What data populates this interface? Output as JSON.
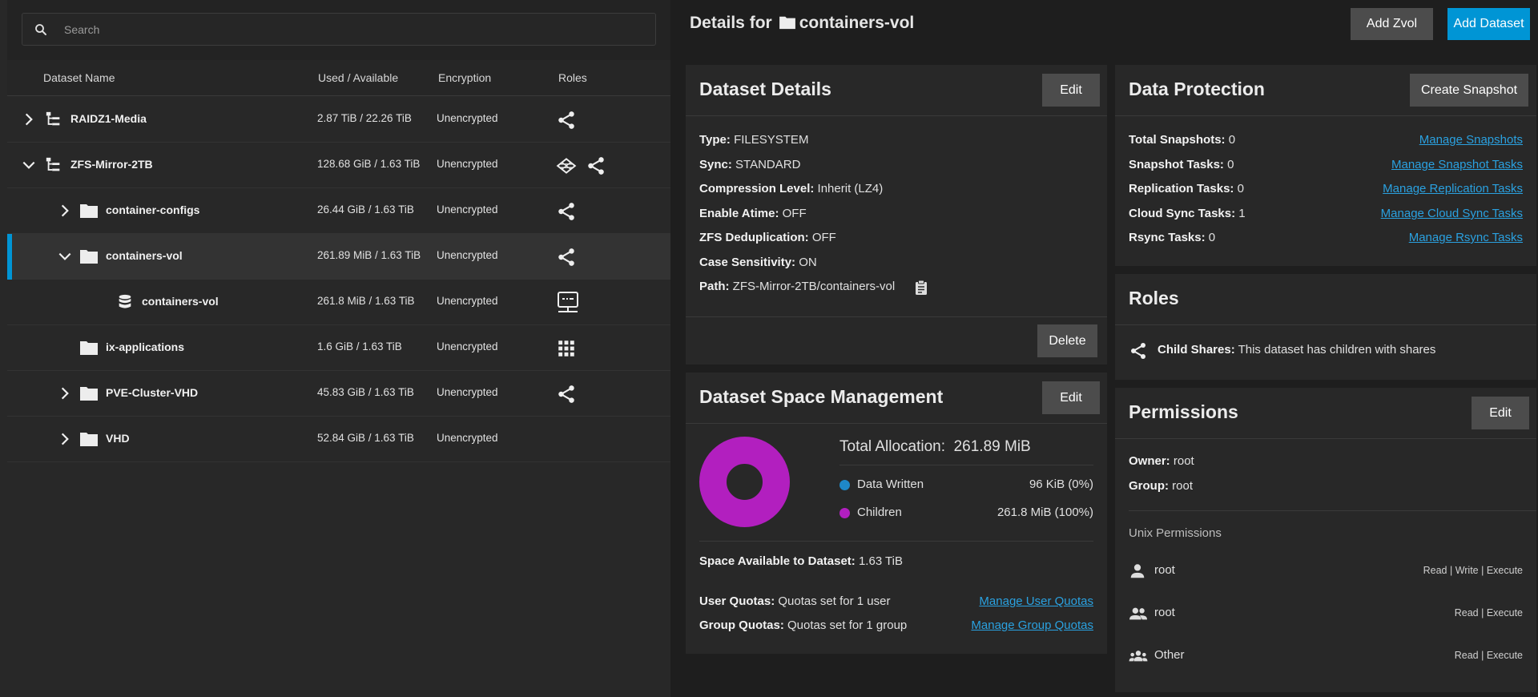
{
  "search": {
    "placeholder": "Search"
  },
  "table": {
    "headers": {
      "name": "Dataset Name",
      "used": "Used / Available",
      "encryption": "Encryption",
      "roles": "Roles"
    },
    "rows": [
      {
        "name": "RAIDZ1-Media",
        "used": "2.87 TiB / 22.26 TiB",
        "encryption": "Unencrypted"
      },
      {
        "name": "ZFS-Mirror-2TB",
        "used": "128.68 GiB / 1.63 TiB",
        "encryption": "Unencrypted"
      },
      {
        "name": "container-configs",
        "used": "26.44 GiB / 1.63 TiB",
        "encryption": "Unencrypted"
      },
      {
        "name": "containers-vol",
        "used": "261.89 MiB / 1.63 TiB",
        "encryption": "Unencrypted"
      },
      {
        "name": "containers-vol",
        "used": "261.8 MiB / 1.63 TiB",
        "encryption": "Unencrypted"
      },
      {
        "name": "ix-applications",
        "used": "1.6 GiB / 1.63 TiB",
        "encryption": "Unencrypted"
      },
      {
        "name": "PVE-Cluster-VHD",
        "used": "45.83 GiB / 1.63 TiB",
        "encryption": "Unencrypted"
      },
      {
        "name": "VHD",
        "used": "52.84 GiB / 1.63 TiB",
        "encryption": "Unencrypted"
      }
    ]
  },
  "header": {
    "prefix": "Details for",
    "dataset": "containers-vol",
    "add_zvol": "Add Zvol",
    "add_dataset": "Add Dataset"
  },
  "dataset_details": {
    "title": "Dataset Details",
    "edit": "Edit",
    "delete": "Delete",
    "fields": [
      {
        "label": "Type:",
        "value": "FILESYSTEM"
      },
      {
        "label": "Sync:",
        "value": "STANDARD"
      },
      {
        "label": "Compression Level:",
        "value": "Inherit (LZ4)"
      },
      {
        "label": "Enable Atime:",
        "value": "OFF"
      },
      {
        "label": "ZFS Deduplication:",
        "value": "OFF"
      },
      {
        "label": "Case Sensitivity:",
        "value": "ON"
      },
      {
        "label": "Path:",
        "value": "ZFS-Mirror-2TB/containers-vol"
      }
    ]
  },
  "space": {
    "title": "Dataset Space Management",
    "edit": "Edit",
    "total_label": "Total Allocation:",
    "total_value": "261.89 MiB",
    "legend": [
      {
        "label": "Data Written",
        "value": "96 KiB (0%)",
        "color": "#1e88c8"
      },
      {
        "label": "Children",
        "value": "261.8 MiB (100%)",
        "color": "#b21fbf"
      }
    ],
    "available_label": "Space Available to Dataset:",
    "available_value": "1.63 TiB",
    "user_quotas_label": "User Quotas:",
    "user_quotas_value": "Quotas set for 1 user",
    "user_quotas_link": "Manage User Quotas",
    "group_quotas_label": "Group Quotas:",
    "group_quotas_value": "Quotas set for 1 group",
    "group_quotas_link": "Manage Group Quotas"
  },
  "protection": {
    "title": "Data Protection",
    "create": "Create Snapshot",
    "rows": [
      {
        "label": "Total Snapshots:",
        "value": "0",
        "link": "Manage Snapshots"
      },
      {
        "label": "Snapshot Tasks:",
        "value": "0",
        "link": "Manage Snapshot Tasks"
      },
      {
        "label": "Replication Tasks:",
        "value": "0",
        "link": "Manage Replication Tasks"
      },
      {
        "label": "Cloud Sync Tasks:",
        "value": "1",
        "link": "Manage Cloud Sync Tasks"
      },
      {
        "label": "Rsync Tasks:",
        "value": "0",
        "link": "Manage Rsync Tasks"
      }
    ]
  },
  "roles": {
    "title": "Roles",
    "label": "Child Shares:",
    "value": "This dataset has children with shares"
  },
  "permissions": {
    "title": "Permissions",
    "edit": "Edit",
    "owner_label": "Owner:",
    "owner_value": "root",
    "group_label": "Group:",
    "group_value": "root",
    "unix_label": "Unix Permissions",
    "entries": [
      {
        "name": "root",
        "perms": "Read | Write | Execute"
      },
      {
        "name": "root",
        "perms": "Read | Execute"
      },
      {
        "name": "Other",
        "perms": "Read | Execute"
      }
    ]
  }
}
